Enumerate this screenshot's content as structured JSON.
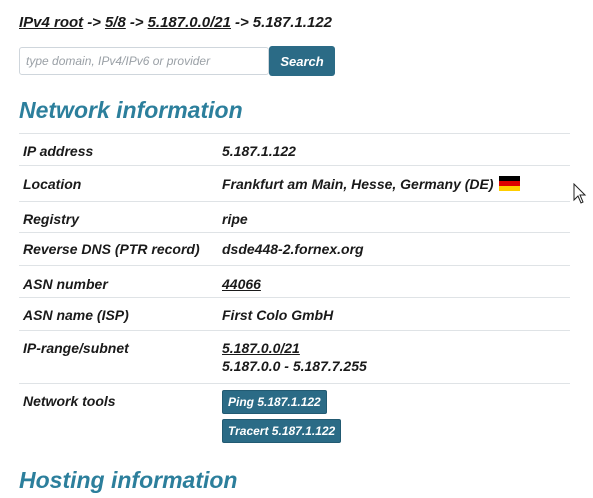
{
  "breadcrumb": {
    "items": [
      "IPv4 root",
      "5/8",
      "5.187.0.0/21"
    ],
    "separator": "->",
    "current": "5.187.1.122"
  },
  "search": {
    "placeholder": "type domain, IPv4/IPv6 or provider",
    "value": "",
    "button_label": "Search"
  },
  "sections": {
    "network_title": "Network information",
    "hosting_title": "Hosting information"
  },
  "network_info": {
    "ip_address": {
      "label": "IP address",
      "value": "5.187.1.122"
    },
    "location": {
      "label": "Location",
      "value": "Frankfurt am Main, Hesse, Germany (DE)",
      "flag": "germany-flag-icon"
    },
    "registry": {
      "label": "Registry",
      "value": "ripe"
    },
    "reverse_dns": {
      "label": "Reverse DNS (PTR record)",
      "value": "dsde448-2.fornex.org"
    },
    "asn_number": {
      "label": "ASN number",
      "value": "44066"
    },
    "asn_name": {
      "label": "ASN name (ISP)",
      "value": "First Colo GmbH"
    },
    "ip_range": {
      "label": "IP-range/subnet",
      "subnet": "5.187.0.0/21",
      "range": "5.187.0.0 - 5.187.7.255"
    },
    "network_tools": {
      "label": "Network tools",
      "ping_label": "Ping 5.187.1.122",
      "tracert_label": "Tracert 5.187.1.122"
    }
  },
  "colors": {
    "accent": "#2c7f9c",
    "button": "#2b6b86",
    "text": "#1a1a1a",
    "row_border": "#dfe3e6"
  }
}
